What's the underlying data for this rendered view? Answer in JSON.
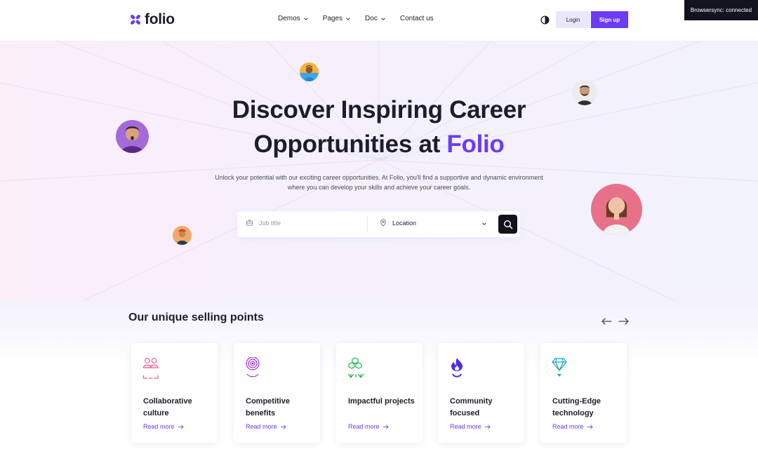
{
  "brand": {
    "name": "folio",
    "accent_color": "#6a3cf3"
  },
  "nav": {
    "items": [
      {
        "label": "Demos",
        "has_dropdown": true
      },
      {
        "label": "Pages",
        "has_dropdown": true
      },
      {
        "label": "Doc",
        "has_dropdown": true
      },
      {
        "label": "Contact us",
        "has_dropdown": false
      }
    ],
    "login_label": "Login",
    "signup_label": "Sign up",
    "theme_icon": "contrast-icon"
  },
  "browsersync": {
    "text": "Browsersync: connected"
  },
  "hero": {
    "title_line1": "Discover Inspiring Career",
    "title_line2_prefix": "Opportunities at",
    "title_line2_accent": "Folio",
    "subtitle": "Unlock your potential with our exciting career opportunities. At Folio, you'll find a supportive and dynamic environment where you can develop your skills and achieve your career goals.",
    "search": {
      "job_placeholder": "Job title",
      "location_value": "Location",
      "job_icon": "briefcase-icon",
      "location_icon": "map-pin-icon",
      "submit_icon": "search-icon"
    }
  },
  "usp": {
    "heading": "Our unique selling points",
    "cards": [
      {
        "title": "Collaborative culture",
        "link": "Read more",
        "icon": "people-icon",
        "color": "#f0568a"
      },
      {
        "title": "Competitive benefits",
        "link": "Read more",
        "icon": "target-icon",
        "color": "#9b2cdb"
      },
      {
        "title": "Impactful projects",
        "link": "Read more",
        "icon": "cubes-icon",
        "color": "#22b04a"
      },
      {
        "title": "Community focused",
        "link": "Read more",
        "icon": "flame-icon",
        "color": "#4a2ee8"
      },
      {
        "title": "Cutting-Edge technology",
        "link": "Read more",
        "icon": "diamond-icon",
        "color": "#14a7b3"
      }
    ]
  }
}
